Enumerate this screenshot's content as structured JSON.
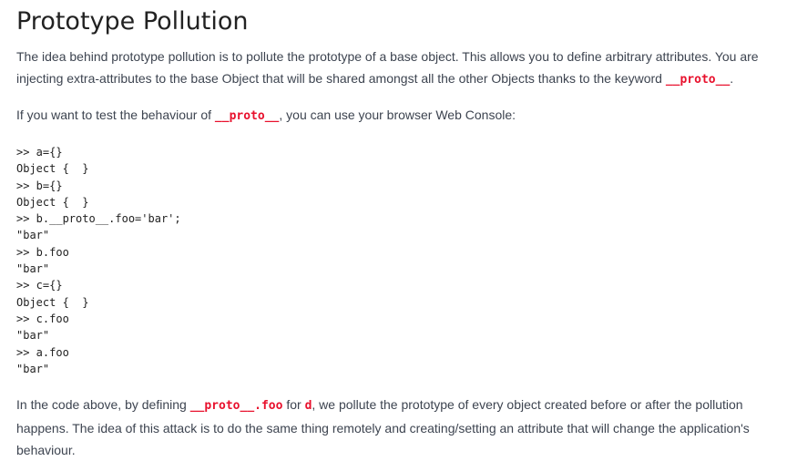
{
  "title": "Prototype Pollution",
  "para1": {
    "text": "The idea behind prototype pollution is to pollute the prototype of a base object. This allows you to define arbitrary attributes. You are injecting extra-attributes to the base Object that will be shared amongst all the other Objects thanks to the keyword ",
    "code": "__proto__",
    "end": "."
  },
  "para2": {
    "text": "If you want to test the behaviour of ",
    "code": "__proto__",
    "end": ", you can use your browser Web Console:"
  },
  "code_block": ">> a={}\nObject {  }\n>> b={}\nObject {  }\n>> b.__proto__.foo='bar';\n\"bar\"\n>> b.foo\n\"bar\"\n>> c={}\nObject {  }\n>> c.foo\n\"bar\"\n>> a.foo\n\"bar\"",
  "para3": {
    "text1": "In the code above, by defining ",
    "code1": "__proto__.foo",
    "text2": " for ",
    "code2": "d",
    "text3": ", we pollute the prototype of every object created before or after the pollution happens. The idea of this attack is to do the same thing remotely and creating/setting an attribute that will change the application's behaviour."
  },
  "colors": {
    "code": "#e8112d",
    "text": "#3d4450"
  }
}
